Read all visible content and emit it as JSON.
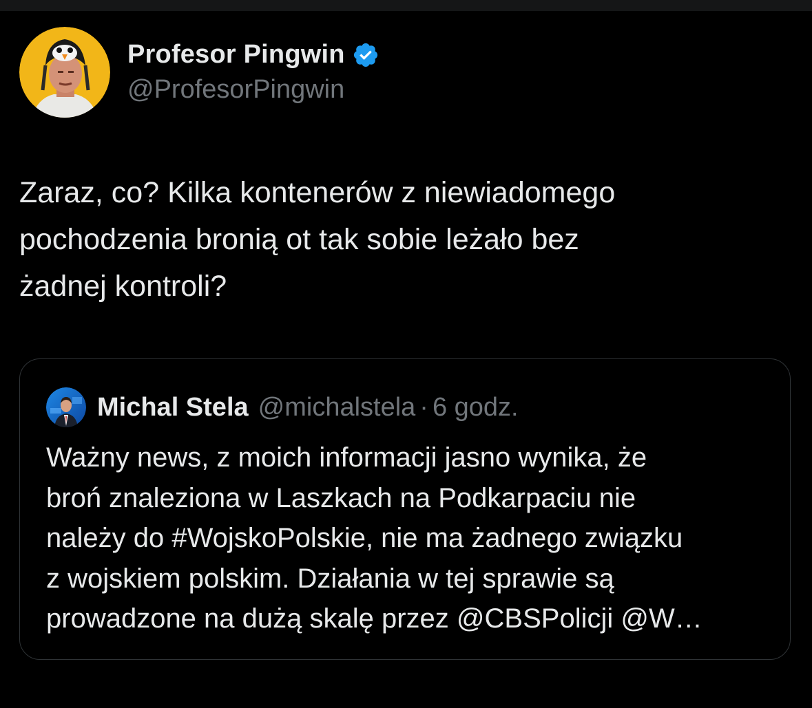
{
  "author": {
    "display_name": "Profesor Pingwin",
    "handle": "@ProfesorPingwin",
    "verified": true,
    "avatar_icon": "penguin-hat-avatar"
  },
  "tweet": {
    "text": "Zaraz, co? Kilka kontenerów z niewiadomego\npochodzenia bronią ot tak sobie leżało bez\nżadnej kontroli?"
  },
  "quoted_tweet": {
    "display_name": "Michal Stela",
    "handle": "@michalstela",
    "separator": "·",
    "time": "6 godz.",
    "avatar_icon": "news-anchor-avatar",
    "text": "Ważny news, z moich informacji jasno wynika, że\nbroń znaleziona w Laszkach na Podkarpaciu nie\nnależy do #WojskoPolskie, nie ma żadnego związku\nz wojskiem polskim. Działania w tej sprawie są\nprowadzone na dużą skalę przez @CBSPolicji @W…"
  },
  "colors": {
    "background": "#000000",
    "text_primary": "#e7e9ea",
    "text_secondary": "#71767b",
    "verified_blue": "#1d9bf0",
    "border": "#2f3336"
  }
}
